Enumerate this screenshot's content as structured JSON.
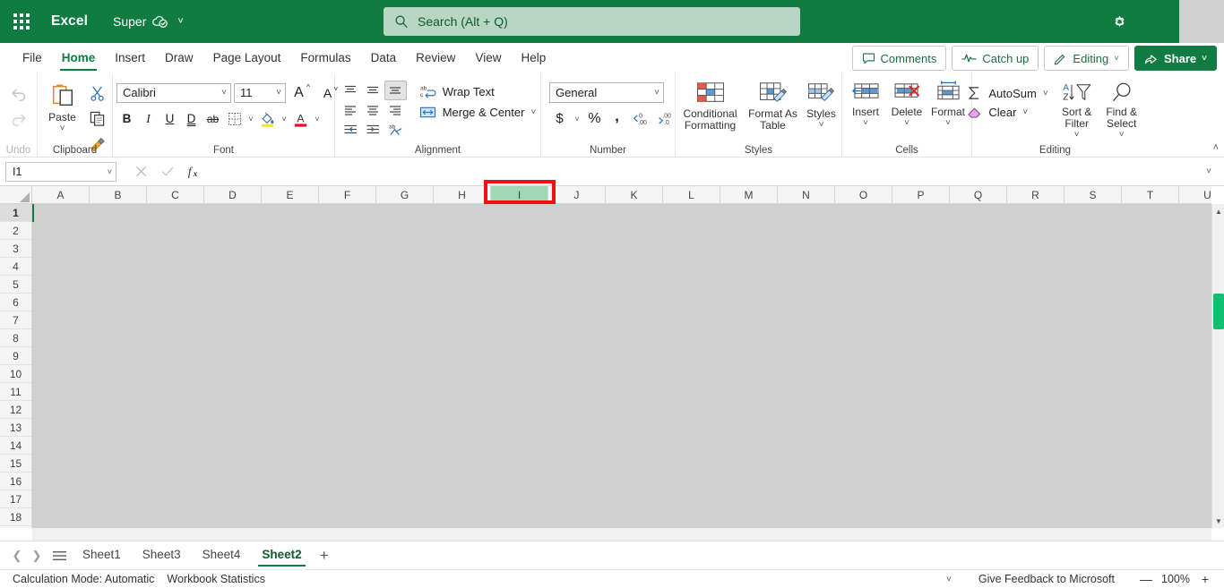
{
  "titlebar": {
    "app_launcher": "app-launcher",
    "brand": "Excel",
    "document_name": "Super",
    "autosave_icon": "cloud-saved-icon",
    "search_placeholder": "Search (Alt + Q)",
    "settings_icon": "gear-icon"
  },
  "ribbon_tabs": [
    {
      "label": "File",
      "active": false
    },
    {
      "label": "Home",
      "active": true
    },
    {
      "label": "Insert",
      "active": false
    },
    {
      "label": "Draw",
      "active": false
    },
    {
      "label": "Page Layout",
      "active": false
    },
    {
      "label": "Formulas",
      "active": false
    },
    {
      "label": "Data",
      "active": false
    },
    {
      "label": "Review",
      "active": false
    },
    {
      "label": "View",
      "active": false
    },
    {
      "label": "Help",
      "active": false
    }
  ],
  "tab_actions": {
    "comments": "Comments",
    "catch_up": "Catch up",
    "editing": "Editing",
    "share": "Share"
  },
  "ribbon": {
    "undo": {
      "group_label": "Undo",
      "undo": "Undo",
      "redo": "Redo"
    },
    "clipboard": {
      "group_label": "Clipboard",
      "paste": "Paste",
      "cut": "Cut",
      "copy": "Copy",
      "format_painter": "Format Painter"
    },
    "font": {
      "group_label": "Font",
      "font_name": "Calibri",
      "font_size": "11",
      "grow_font": "A",
      "shrink_font": "A",
      "bold": "B",
      "italic": "I",
      "underline": "U",
      "double_underline": "D",
      "strikethrough": "ab",
      "borders": "Borders",
      "fill_color": "Fill Color",
      "font_color": "Font Color"
    },
    "alignment": {
      "group_label": "Alignment",
      "wrap_text": "Wrap Text",
      "merge_center": "Merge & Center"
    },
    "number": {
      "group_label": "Number",
      "format": "General",
      "accounting": "$",
      "percent": "%",
      "comma": ",",
      "increase_decimal": "Increase Decimal",
      "decrease_decimal": "Decrease Decimal"
    },
    "styles": {
      "group_label": "Styles",
      "conditional_formatting": "Conditional Formatting",
      "format_as_table": "Format As Table",
      "cell_styles": "Styles"
    },
    "cells": {
      "group_label": "Cells",
      "insert": "Insert",
      "delete": "Delete",
      "format": "Format"
    },
    "editing": {
      "group_label": "Editing",
      "autosum": "AutoSum",
      "clear": "Clear",
      "sort_filter": "Sort & Filter",
      "find_select": "Find & Select"
    }
  },
  "formula_bar": {
    "name_box_value": "I1",
    "cancel_icon": "cancel-icon",
    "enter_icon": "check-icon",
    "function_icon": "fx",
    "formula_value": "",
    "expand_icon": "chevron-down-icon"
  },
  "grid": {
    "columns": [
      "A",
      "B",
      "C",
      "D",
      "E",
      "F",
      "G",
      "H",
      "I",
      "J",
      "K",
      "L",
      "M",
      "N",
      "O",
      "P",
      "Q",
      "R",
      "S",
      "T",
      "U"
    ],
    "selected_column": "I",
    "rows": [
      "1",
      "2",
      "3",
      "4",
      "5",
      "6",
      "7",
      "8",
      "9",
      "10",
      "11",
      "12",
      "13",
      "14",
      "15",
      "16",
      "17",
      "18"
    ],
    "selected_row": "1",
    "active_cell": "I1"
  },
  "sheet_tabs": {
    "prev_icon": "chevron-left-icon",
    "next_icon": "chevron-right-icon",
    "all_sheets_icon": "list-icon",
    "tabs": [
      {
        "label": "Sheet1",
        "active": false
      },
      {
        "label": "Sheet3",
        "active": false
      },
      {
        "label": "Sheet4",
        "active": false
      },
      {
        "label": "Sheet2",
        "active": true
      }
    ],
    "add_sheet": "+"
  },
  "status_bar": {
    "calculation_mode": "Calculation Mode: Automatic",
    "workbook_statistics": "Workbook Statistics",
    "feedback": "Give Feedback to Microsoft",
    "zoom_out": "—",
    "zoom_level": "100%",
    "zoom_in": "+"
  },
  "colors": {
    "brand_green": "#107c41",
    "search_bg": "#b9d5c4",
    "selected_col_header": "#a0d8b6",
    "grid_selected_bg": "#d0d0d0",
    "annotation_red": "#ee1111",
    "scroll_thumb": "#0fbf72"
  }
}
